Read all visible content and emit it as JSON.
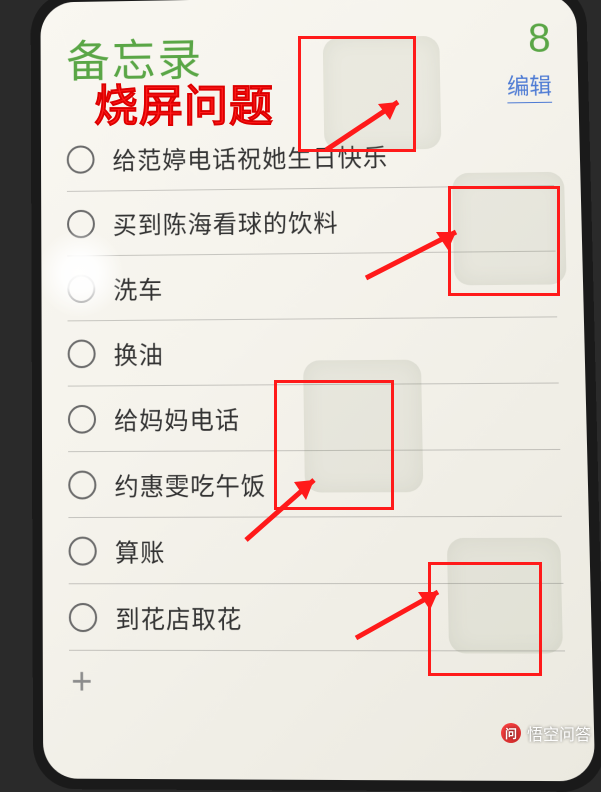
{
  "header": {
    "title": "备忘录",
    "count": "8",
    "edit_label": "编辑"
  },
  "annotation_label": "烧屏问题",
  "list_items": [
    {
      "text": "给范婷电话祝她生日快乐"
    },
    {
      "text": "买到陈海看球的饮料"
    },
    {
      "text": "洗车"
    },
    {
      "text": "换油"
    },
    {
      "text": "给妈妈电话"
    },
    {
      "text": "约惠雯吃午饭"
    },
    {
      "text": "算账"
    },
    {
      "text": "到花店取花"
    }
  ],
  "add_icon_glyph": "+",
  "watermark": {
    "text": "悟空问答"
  }
}
